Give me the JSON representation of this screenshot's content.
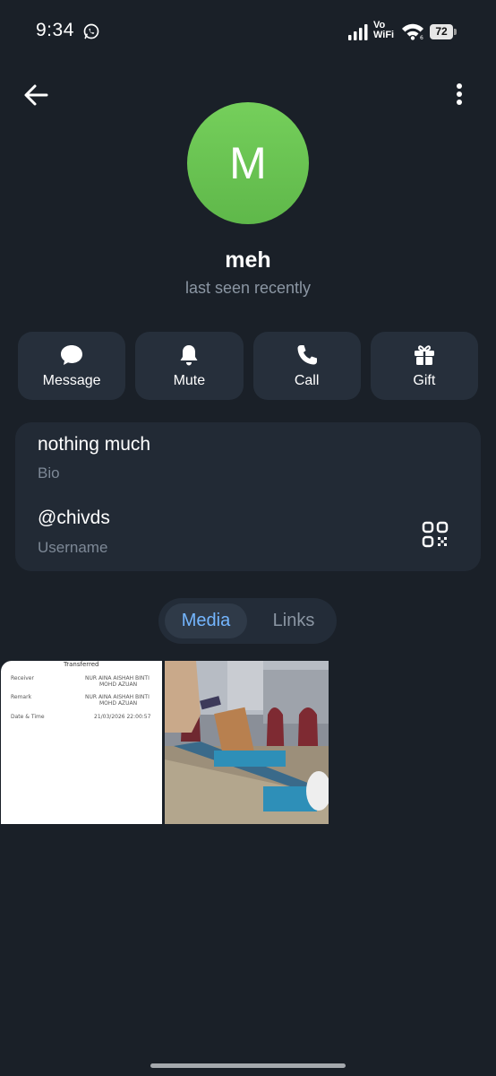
{
  "status_bar": {
    "time": "9:34",
    "volte_line1": "Vo",
    "volte_line2": "WiFi",
    "wifi_sub": "6",
    "battery": "72"
  },
  "profile": {
    "avatar_letter": "M",
    "avatar_color": "#6cc455",
    "name": "meh",
    "status": "last seen recently"
  },
  "actions": [
    {
      "label": "Message",
      "icon": "chat-bubble-icon"
    },
    {
      "label": "Mute",
      "icon": "bell-icon"
    },
    {
      "label": "Call",
      "icon": "phone-icon"
    },
    {
      "label": "Gift",
      "icon": "gift-icon"
    }
  ],
  "info": {
    "bio": "nothing much",
    "bio_label": "Bio",
    "username": "@chivds",
    "username_label": "Username"
  },
  "tabs": {
    "media": "Media",
    "links": "Links",
    "active": "Media"
  },
  "media": {
    "receipt": {
      "title": "Transferred",
      "rows": [
        {
          "k": "Receiver",
          "v1": "NUR AINA AISHAH BINTI",
          "v2": "MOHD AZUAN"
        },
        {
          "k": "Remark",
          "v1": "NUR AINA AISHAH BINTI",
          "v2": "MOHD AZUAN"
        },
        {
          "k": "Date & Time",
          "v1": "21/03/2026 22:00:57",
          "v2": ""
        }
      ]
    }
  },
  "colors": {
    "background": "#1a2028",
    "card": "#222a35",
    "button": "#262f3b",
    "accent": "#74b6ff",
    "secondary_text": "#8b96a3"
  }
}
